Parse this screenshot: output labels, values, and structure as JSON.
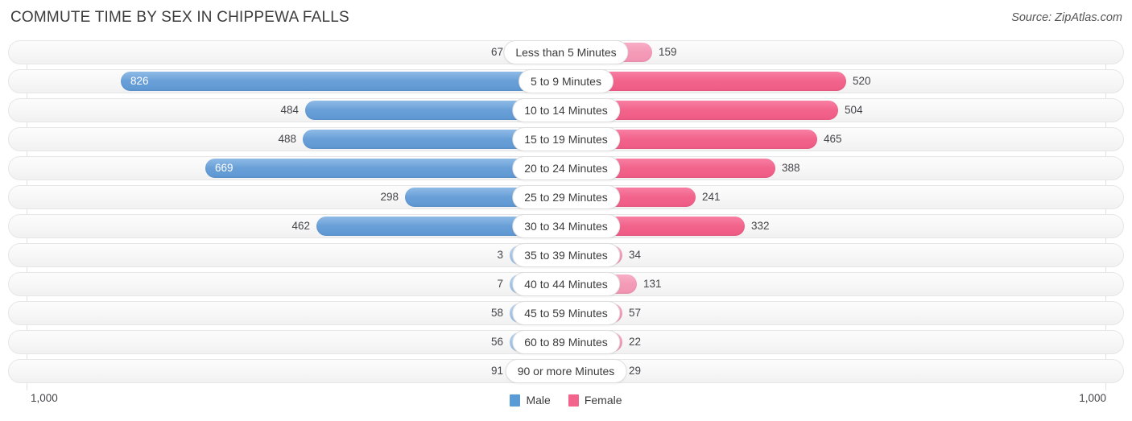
{
  "header": {
    "title": "COMMUTE TIME BY SEX IN CHIPPEWA FALLS",
    "source": "Source: ZipAtlas.com"
  },
  "axis": {
    "left_label": "1,000",
    "right_label": "1,000",
    "max": 1000
  },
  "legend": {
    "male_label": "Male",
    "female_label": "Female",
    "male_color": "#5b9bd5",
    "female_color": "#f2648c"
  },
  "chart_data": {
    "type": "bar",
    "title": "COMMUTE TIME BY SEX IN CHIPPEWA FALLS",
    "subtitle": "Source: ZipAtlas.com",
    "orientation": "horizontal-diverging",
    "xlabel": "",
    "ylabel": "",
    "xlim": [
      1000,
      1000
    ],
    "grid": true,
    "legend_position": "bottom-center",
    "categories": [
      "Less than 5 Minutes",
      "5 to 9 Minutes",
      "10 to 14 Minutes",
      "15 to 19 Minutes",
      "20 to 24 Minutes",
      "25 to 29 Minutes",
      "30 to 34 Minutes",
      "35 to 39 Minutes",
      "40 to 44 Minutes",
      "45 to 59 Minutes",
      "60 to 89 Minutes",
      "90 or more Minutes"
    ],
    "series": [
      {
        "name": "Male",
        "color": "#5b9bd5",
        "values": [
          67,
          826,
          484,
          488,
          669,
          298,
          462,
          3,
          7,
          58,
          56,
          91
        ]
      },
      {
        "name": "Female",
        "color": "#f2648c",
        "values": [
          159,
          520,
          504,
          465,
          388,
          241,
          332,
          34,
          131,
          57,
          22,
          29
        ]
      }
    ]
  },
  "rows": [
    {
      "category": "Less than 5 Minutes",
      "male": 67,
      "male_text": "67",
      "female": 159,
      "female_text": "159",
      "male_inside": false,
      "female_inside": false,
      "male_pale": true,
      "female_pale": true
    },
    {
      "category": "5 to 9 Minutes",
      "male": 826,
      "male_text": "826",
      "female": 520,
      "female_text": "520",
      "male_inside": true,
      "female_inside": false,
      "male_pale": false,
      "female_pale": false
    },
    {
      "category": "10 to 14 Minutes",
      "male": 484,
      "male_text": "484",
      "female": 504,
      "female_text": "504",
      "male_inside": false,
      "female_inside": false,
      "male_pale": false,
      "female_pale": false
    },
    {
      "category": "15 to 19 Minutes",
      "male": 488,
      "male_text": "488",
      "female": 465,
      "female_text": "465",
      "male_inside": false,
      "female_inside": false,
      "male_pale": false,
      "female_pale": false
    },
    {
      "category": "20 to 24 Minutes",
      "male": 669,
      "male_text": "669",
      "female": 388,
      "female_text": "388",
      "male_inside": true,
      "female_inside": false,
      "male_pale": false,
      "female_pale": false
    },
    {
      "category": "25 to 29 Minutes",
      "male": 298,
      "male_text": "298",
      "female": 241,
      "female_text": "241",
      "male_inside": false,
      "female_inside": false,
      "male_pale": false,
      "female_pale": false
    },
    {
      "category": "30 to 34 Minutes",
      "male": 462,
      "male_text": "462",
      "female": 332,
      "female_text": "332",
      "male_inside": false,
      "female_inside": false,
      "male_pale": false,
      "female_pale": false
    },
    {
      "category": "35 to 39 Minutes",
      "male": 3,
      "male_text": "3",
      "female": 34,
      "female_text": "34",
      "male_inside": false,
      "female_inside": false,
      "male_pale": true,
      "female_pale": true
    },
    {
      "category": "40 to 44 Minutes",
      "male": 7,
      "male_text": "7",
      "female": 131,
      "female_text": "131",
      "male_inside": false,
      "female_inside": false,
      "male_pale": true,
      "female_pale": true
    },
    {
      "category": "45 to 59 Minutes",
      "male": 58,
      "male_text": "58",
      "female": 57,
      "female_text": "57",
      "male_inside": false,
      "female_inside": false,
      "male_pale": true,
      "female_pale": true
    },
    {
      "category": "60 to 89 Minutes",
      "male": 56,
      "male_text": "56",
      "female": 22,
      "female_text": "22",
      "male_inside": false,
      "female_inside": false,
      "male_pale": true,
      "female_pale": true
    },
    {
      "category": "90 or more Minutes",
      "male": 91,
      "male_text": "91",
      "female": 29,
      "female_text": "29",
      "male_inside": false,
      "female_inside": false,
      "male_pale": true,
      "female_pale": true
    }
  ]
}
